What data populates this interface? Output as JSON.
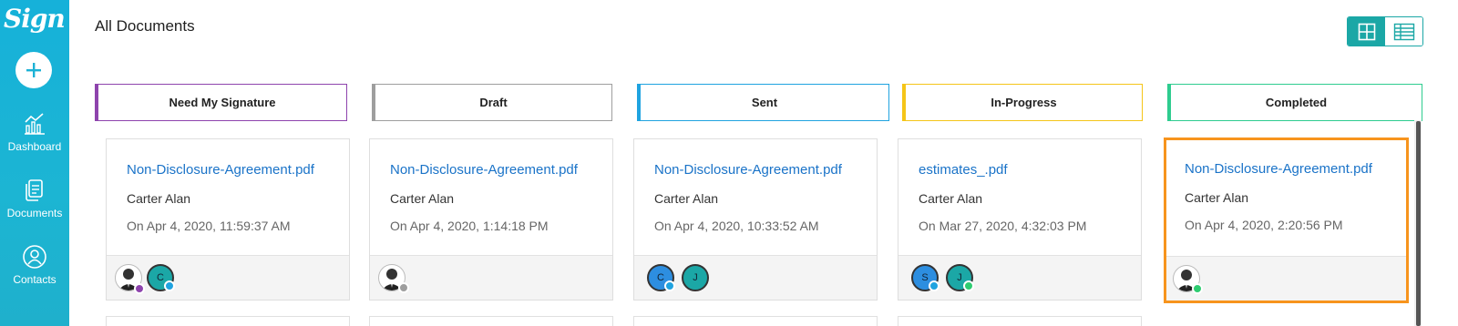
{
  "app": {
    "logo_text": "Sign"
  },
  "sidebar": {
    "add_label": "+",
    "items": [
      {
        "label": "Dashboard",
        "icon": "dashboard-chart-icon"
      },
      {
        "label": "Documents",
        "icon": "documents-icon"
      },
      {
        "label": "Contacts",
        "icon": "contacts-icon"
      }
    ]
  },
  "page": {
    "title": "All Documents"
  },
  "view_toggle": {
    "options": [
      "grid-view-icon",
      "table-view-icon"
    ],
    "active": "grid"
  },
  "columns": [
    {
      "title": "Need My Signature",
      "color": "#8e44ad",
      "card": {
        "name": "Non-Disclosure-Agreement.pdf",
        "owner": "Carter Alan",
        "date": "On Apr 4, 2020, 11:59:37 AM",
        "avatars": [
          {
            "type": "photo",
            "dot": "#8e44ad"
          },
          {
            "type": "initial",
            "initial": "C",
            "bg": "#1ba7a6",
            "dot": "#1fa3e0"
          }
        ]
      }
    },
    {
      "title": "Draft",
      "color": "#9e9e9e",
      "card": {
        "name": "Non-Disclosure-Agreement.pdf",
        "owner": "Carter Alan",
        "date": "On Apr 4, 2020, 1:14:18 PM",
        "avatars": [
          {
            "type": "photo",
            "dot": "#9e9e9e"
          }
        ]
      }
    },
    {
      "title": "Sent",
      "color": "#1fa3e0",
      "card": {
        "name": "Non-Disclosure-Agreement.pdf",
        "owner": "Carter Alan",
        "date": "On Apr 4, 2020, 10:33:52 AM",
        "avatars": [
          {
            "type": "initial",
            "initial": "C",
            "bg": "#2d8ee0",
            "dot": "#1fa3e0"
          },
          {
            "type": "initial",
            "initial": "J",
            "bg": "#1ba7a6",
            "dot": null
          }
        ]
      }
    },
    {
      "title": "In-Progress",
      "color": "#f5c518",
      "card": {
        "name": "estimates_.pdf",
        "owner": "Carter Alan",
        "date": "On Mar 27, 2020, 4:32:03 PM",
        "avatars": [
          {
            "type": "initial",
            "initial": "S",
            "bg": "#2d8ee0",
            "dot": "#1fa3e0"
          },
          {
            "type": "initial",
            "initial": "J",
            "bg": "#1ba7a6",
            "dot": "#2ecc71"
          }
        ]
      }
    },
    {
      "title": "Completed",
      "color": "#2ecc8f",
      "card": {
        "name": "Non-Disclosure-Agreement.pdf",
        "owner": "Carter Alan",
        "date": "On Apr 4, 2020, 2:20:56 PM",
        "selected": true,
        "avatars": [
          {
            "type": "photo",
            "dot": "#2ecc71"
          }
        ]
      }
    }
  ]
}
